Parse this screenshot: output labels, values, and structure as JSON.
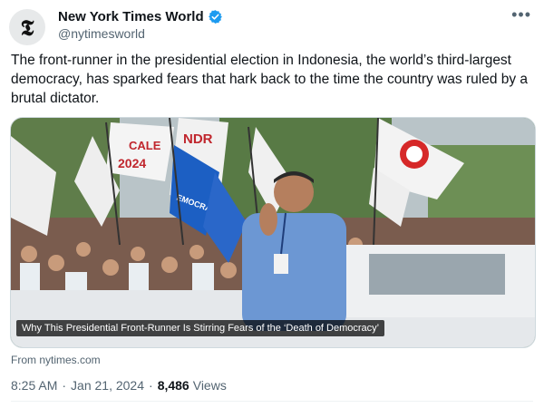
{
  "tweet": {
    "author_name": "New York Times World",
    "author_handle": "@nytimesworld",
    "avatar_glyph": "𝕿",
    "text": "The front-runner in the presidential election in Indonesia, the world’s third-largest democracy, has sparked fears that hark back to the time the country was ruled by a brutal dictator.",
    "card": {
      "headline": "Why This Presidential Front-Runner Is Stirring Fears of the ‘Death of Democracy’",
      "source": "From nytimes.com",
      "banner_texts": [
        "CALE",
        "NDR",
        "2024",
        "EMOCRA"
      ]
    },
    "time": "8:25 AM",
    "date": "Jan 21, 2024",
    "views_count": "8,486",
    "views_label": "Views"
  },
  "colors": {
    "verified": "#1d9bf0",
    "muted_text": "#536471",
    "primary_text": "#0f1419"
  },
  "icons": [
    "verified-badge-icon",
    "more-options-icon"
  ]
}
